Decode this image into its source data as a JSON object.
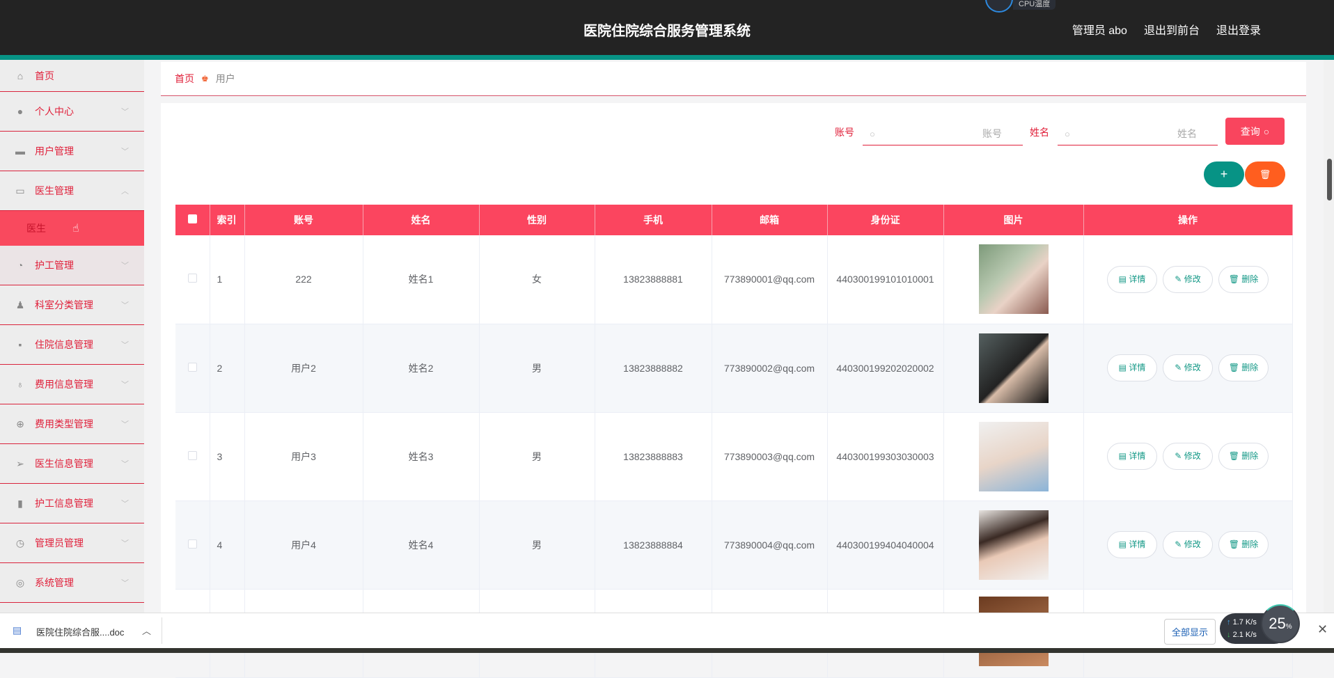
{
  "header": {
    "title": "医院住院综合服务管理系统",
    "user": "管理员 abo",
    "to_front": "退出到前台",
    "logout": "退出登录",
    "cpu_label": "CPU温度"
  },
  "sidebar": {
    "items": [
      {
        "label": "首页",
        "icon": "home-icon"
      },
      {
        "label": "个人中心",
        "icon": "user-icon"
      },
      {
        "label": "用户管理",
        "icon": "ticket-icon"
      },
      {
        "label": "医生管理",
        "icon": "monitor-icon",
        "expanded": true,
        "children": [
          {
            "label": "医生"
          }
        ]
      },
      {
        "label": "护工管理",
        "icon": "gauge-icon"
      },
      {
        "label": "科室分类管理",
        "icon": "stamp-icon"
      },
      {
        "label": "住院信息管理",
        "icon": "chat-icon"
      },
      {
        "label": "费用信息管理",
        "icon": "microphone-icon"
      },
      {
        "label": "费用类型管理",
        "icon": "target-icon"
      },
      {
        "label": "医生信息管理",
        "icon": "send-icon"
      },
      {
        "label": "护工信息管理",
        "icon": "bar-chart-icon"
      },
      {
        "label": "管理员管理",
        "icon": "clock-icon"
      },
      {
        "label": "系统管理",
        "icon": "lifebuoy-icon"
      }
    ]
  },
  "breadcrumb": {
    "home": "首页",
    "current": "用户"
  },
  "search": {
    "account_label": "账号",
    "account_placeholder": "账号",
    "name_label": "姓名",
    "name_placeholder": "姓名",
    "query": "查询"
  },
  "table": {
    "columns": [
      "索引",
      "账号",
      "姓名",
      "性别",
      "手机",
      "邮箱",
      "身份证",
      "图片",
      "操作"
    ],
    "rows": [
      {
        "index": "1",
        "account": "222",
        "name": "姓名1",
        "gender": "女",
        "phone": "13823888881",
        "email": "773890001@qq.com",
        "id": "440300199101010001"
      },
      {
        "index": "2",
        "account": "用户2",
        "name": "姓名2",
        "gender": "男",
        "phone": "13823888882",
        "email": "773890002@qq.com",
        "id": "440300199202020002"
      },
      {
        "index": "3",
        "account": "用户3",
        "name": "姓名3",
        "gender": "男",
        "phone": "13823888883",
        "email": "773890003@qq.com",
        "id": "440300199303030003"
      },
      {
        "index": "4",
        "account": "用户4",
        "name": "姓名4",
        "gender": "男",
        "phone": "13823888884",
        "email": "773890004@qq.com",
        "id": "440300199404040004"
      }
    ],
    "actions": {
      "detail": "详情",
      "edit": "修改",
      "delete": "删除"
    }
  },
  "download_bar": {
    "file": "医院住院综合服....doc",
    "show_all": "全部显示",
    "upload": "1.7",
    "download": "2.1",
    "unit": "K/s",
    "percent": "25"
  },
  "colors": {
    "accent": "#fb455f",
    "teal": "#079385",
    "orange": "#ff5e1f",
    "header": "#232323"
  }
}
